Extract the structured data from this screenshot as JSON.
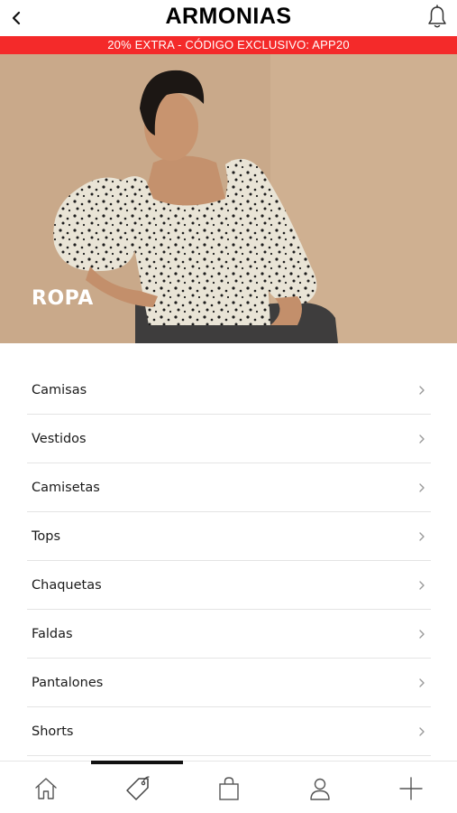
{
  "header": {
    "logo": "ARMONIAS",
    "back_icon": "chevron-left-icon",
    "notification_icon": "bell-icon"
  },
  "promo": {
    "text": "20% EXTRA - CÓDIGO EXCLUSIVO: APP20",
    "background": "#f42a2a"
  },
  "hero": {
    "title": "ROPA"
  },
  "menu": {
    "items": [
      {
        "label": "Camisas"
      },
      {
        "label": "Vestidos"
      },
      {
        "label": "Camisetas"
      },
      {
        "label": "Tops"
      },
      {
        "label": "Chaquetas"
      },
      {
        "label": "Faldas"
      },
      {
        "label": "Pantalones"
      },
      {
        "label": "Shorts"
      }
    ]
  },
  "tabbar": {
    "tabs": [
      {
        "icon": "home-icon"
      },
      {
        "icon": "tag-icon",
        "active": true
      },
      {
        "icon": "shopping-bag-icon"
      },
      {
        "icon": "user-icon"
      },
      {
        "icon": "plus-icon"
      }
    ]
  }
}
